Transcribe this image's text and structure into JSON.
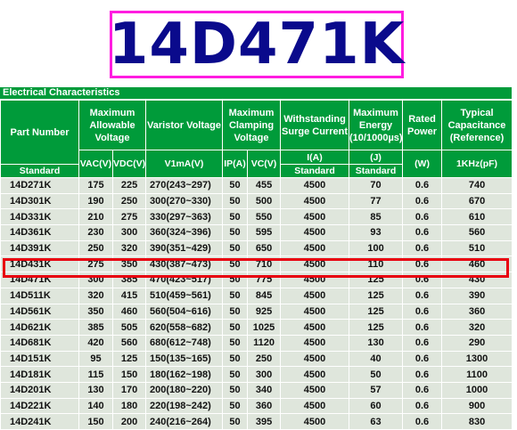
{
  "title": "14D471K",
  "section_title": "Electrical Characteristics",
  "headers": {
    "part_number": "Part Number",
    "standard": "Standard",
    "max_allowable_voltage": "Maximum Allowable Voltage",
    "varistor_voltage": "Varistor Voltage",
    "max_clamping_voltage": "Maximum Clamping Voltage",
    "withstanding_surge_current": "Withstanding Surge Current",
    "max_energy": "Maximum Energy (10/1000µs)",
    "rated_power": "Rated Power",
    "typical_capacitance": "Typical Capacitance (Reference)",
    "vac": "VAC(V)",
    "vdc": "VDC(V)",
    "v1ma": "V1mA(V)",
    "ip": "IP(A)",
    "vc": "VC(V)",
    "i_a": "I(A)",
    "j": "(J)",
    "w": "(W)",
    "khz": "1KHz(pF)",
    "standard_a": "Standard",
    "standard_j": "Standard"
  },
  "rows": [
    {
      "part": "14D271K",
      "vac": "175",
      "vdc": "225",
      "var": "270(243~297)",
      "ip": "50",
      "vc": "455",
      "i": "4500",
      "j": "70",
      "w": "0.6",
      "cap": "740"
    },
    {
      "part": "14D301K",
      "vac": "190",
      "vdc": "250",
      "var": "300(270~330)",
      "ip": "50",
      "vc": "500",
      "i": "4500",
      "j": "77",
      "w": "0.6",
      "cap": "670"
    },
    {
      "part": "14D331K",
      "vac": "210",
      "vdc": "275",
      "var": "330(297~363)",
      "ip": "50",
      "vc": "550",
      "i": "4500",
      "j": "85",
      "w": "0.6",
      "cap": "610"
    },
    {
      "part": "14D361K",
      "vac": "230",
      "vdc": "300",
      "var": "360(324~396)",
      "ip": "50",
      "vc": "595",
      "i": "4500",
      "j": "93",
      "w": "0.6",
      "cap": "560"
    },
    {
      "part": "14D391K",
      "vac": "250",
      "vdc": "320",
      "var": "390(351~429)",
      "ip": "50",
      "vc": "650",
      "i": "4500",
      "j": "100",
      "w": "0.6",
      "cap": "510"
    },
    {
      "part": "14D431K",
      "vac": "275",
      "vdc": "350",
      "var": "430(387~473)",
      "ip": "50",
      "vc": "710",
      "i": "4500",
      "j": "110",
      "w": "0.6",
      "cap": "460"
    },
    {
      "part": "14D471K",
      "vac": "300",
      "vdc": "385",
      "var": "470(423~517)",
      "ip": "50",
      "vc": "775",
      "i": "4500",
      "j": "125",
      "w": "0.6",
      "cap": "430"
    },
    {
      "part": "14D511K",
      "vac": "320",
      "vdc": "415",
      "var": "510(459~561)",
      "ip": "50",
      "vc": "845",
      "i": "4500",
      "j": "125",
      "w": "0.6",
      "cap": "390"
    },
    {
      "part": "14D561K",
      "vac": "350",
      "vdc": "460",
      "var": "560(504~616)",
      "ip": "50",
      "vc": "925",
      "i": "4500",
      "j": "125",
      "w": "0.6",
      "cap": "360"
    },
    {
      "part": "14D621K",
      "vac": "385",
      "vdc": "505",
      "var": "620(558~682)",
      "ip": "50",
      "vc": "1025",
      "i": "4500",
      "j": "125",
      "w": "0.6",
      "cap": "320"
    },
    {
      "part": "14D681K",
      "vac": "420",
      "vdc": "560",
      "var": "680(612~748)",
      "ip": "50",
      "vc": "1120",
      "i": "4500",
      "j": "130",
      "w": "0.6",
      "cap": "290"
    },
    {
      "part": "14D151K",
      "vac": "95",
      "vdc": "125",
      "var": "150(135~165)",
      "ip": "50",
      "vc": "250",
      "i": "4500",
      "j": "40",
      "w": "0.6",
      "cap": "1300"
    },
    {
      "part": "14D181K",
      "vac": "115",
      "vdc": "150",
      "var": "180(162~198)",
      "ip": "50",
      "vc": "300",
      "i": "4500",
      "j": "50",
      "w": "0.6",
      "cap": "1100"
    },
    {
      "part": "14D201K",
      "vac": "130",
      "vdc": "170",
      "var": "200(180~220)",
      "ip": "50",
      "vc": "340",
      "i": "4500",
      "j": "57",
      "w": "0.6",
      "cap": "1000"
    },
    {
      "part": "14D221K",
      "vac": "140",
      "vdc": "180",
      "var": "220(198~242)",
      "ip": "50",
      "vc": "360",
      "i": "4500",
      "j": "60",
      "w": "0.6",
      "cap": "900"
    },
    {
      "part": "14D241K",
      "vac": "150",
      "vdc": "200",
      "var": "240(216~264)",
      "ip": "50",
      "vc": "395",
      "i": "4500",
      "j": "63",
      "w": "0.6",
      "cap": "830"
    }
  ],
  "highlighted_part": "14D471K",
  "colors": {
    "header_green": "#009b3a",
    "row_bg": "#dfe6dc",
    "title_blue": "#0a0a8c",
    "title_border": "#ff1ce0",
    "highlight_red": "#e8000f"
  }
}
